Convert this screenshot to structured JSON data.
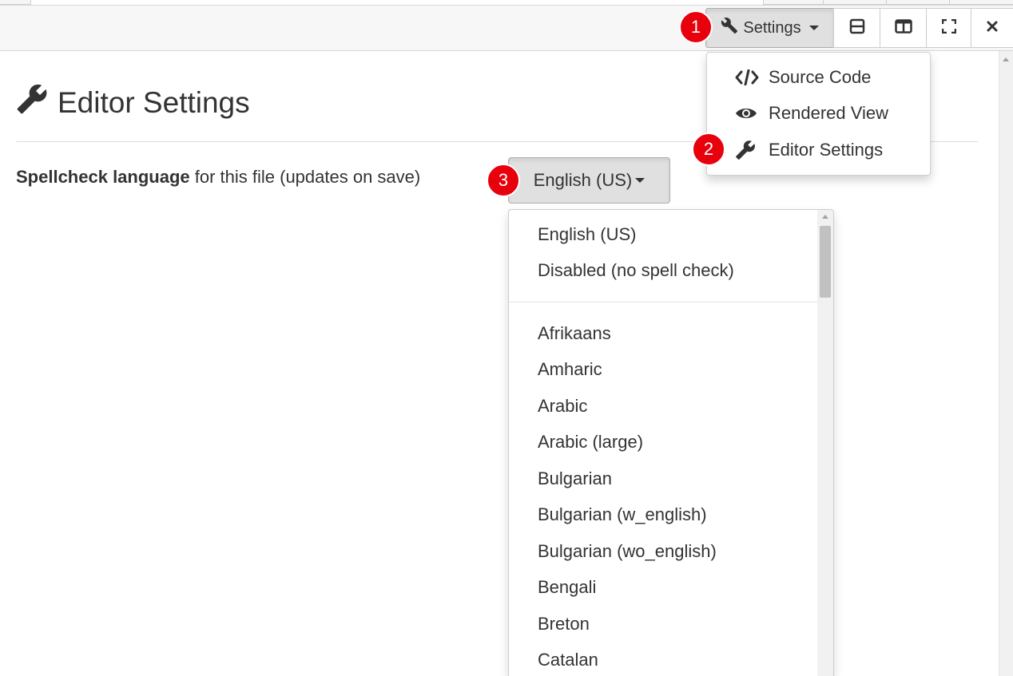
{
  "toolbar": {
    "settings_label": "Settings",
    "buttons": [
      {
        "icon": "split-horizontal-icon"
      },
      {
        "icon": "split-vertical-icon"
      },
      {
        "icon": "fullscreen-icon"
      },
      {
        "icon": "close-icon"
      }
    ]
  },
  "badges": {
    "one": "1",
    "two": "2",
    "three": "3"
  },
  "settings_menu": {
    "items": [
      {
        "label": "Source Code",
        "icon": "code-icon"
      },
      {
        "label": "Rendered View",
        "icon": "eye-icon"
      },
      {
        "label": "Editor Settings",
        "icon": "wrench-icon"
      }
    ]
  },
  "page": {
    "title": "Editor Settings",
    "spellcheck_label_bold": "Spellcheck language",
    "spellcheck_label_rest": " for this file (updates on save)",
    "selected_language": "English (US)"
  },
  "language_list": {
    "top": [
      "English (US)",
      "Disabled (no spell check)"
    ],
    "languages": [
      "Afrikaans",
      "Amharic",
      "Arabic",
      "Arabic (large)",
      "Bulgarian",
      "Bulgarian (w_english)",
      "Bulgarian (wo_english)",
      "Bengali",
      "Breton",
      "Catalan"
    ]
  },
  "colors": {
    "badge": "#e8000c",
    "text": "#333333",
    "active_button": "#e0e0e0"
  }
}
